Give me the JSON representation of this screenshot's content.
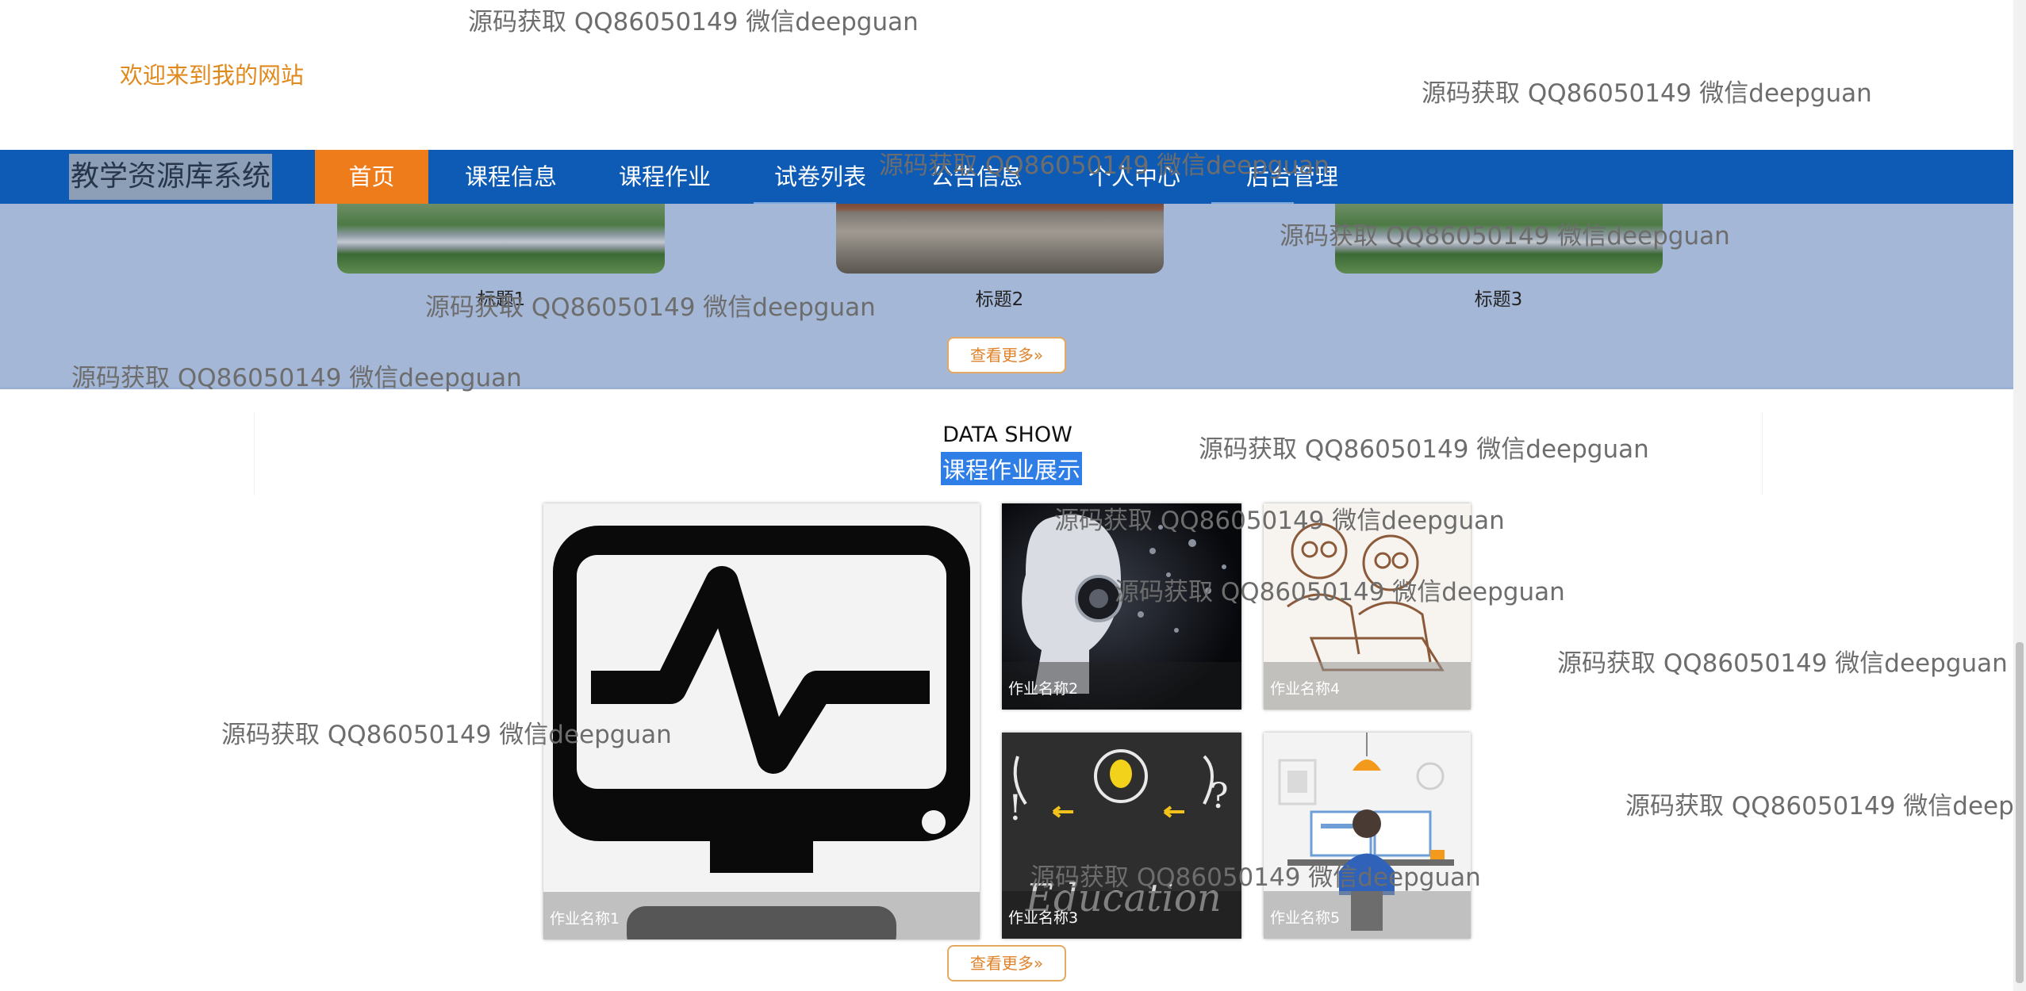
{
  "header": {
    "welcome": "欢迎来到我的网站",
    "brand": "教学资源库系统"
  },
  "nav": [
    {
      "label": "首页",
      "active": true
    },
    {
      "label": "课程信息"
    },
    {
      "label": "课程作业"
    },
    {
      "label": "试卷列表"
    },
    {
      "label": "公告信息"
    },
    {
      "label": "个人中心"
    },
    {
      "label": "后台管理"
    }
  ],
  "banner": {
    "items": [
      {
        "title": "标题1"
      },
      {
        "title": "标题2"
      },
      {
        "title": "标题3"
      }
    ],
    "more": "查看更多»"
  },
  "showcase": {
    "en": "DATA SHOW",
    "cn": "课程作业展示",
    "items": [
      {
        "name": "作业名称1",
        "icon": "monitor-heartbeat-icon"
      },
      {
        "name": "作业名称2",
        "icon": "robot-head-image"
      },
      {
        "name": "作业名称3",
        "icon": "education-lightbulb-image"
      },
      {
        "name": "作业名称4",
        "icon": "sketch-people-laptop-image"
      },
      {
        "name": "作业名称5",
        "icon": "desk-workstation-image"
      }
    ],
    "more": "查看更多»"
  },
  "watermark": "源码获取 QQ86050149 微信deepguan",
  "colors": {
    "nav_bg": "#0e5bb5",
    "active": "#ef7c1a",
    "welcome": "#e08a1e",
    "band": "#a4b7d6"
  }
}
